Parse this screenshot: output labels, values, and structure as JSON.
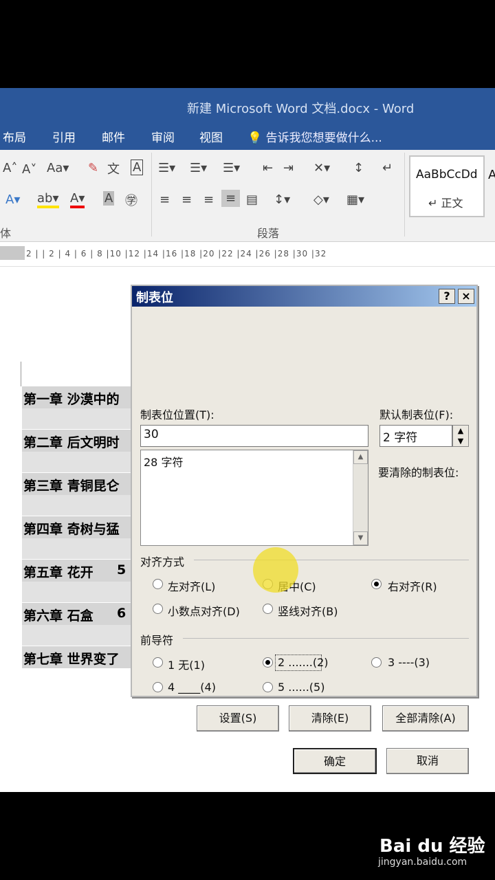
{
  "window": {
    "title": "新建 Microsoft Word 文档.docx - Word"
  },
  "menu": {
    "items": [
      "布局",
      "引用",
      "邮件",
      "审阅",
      "视图"
    ],
    "tellme": "告诉我您想要做什么..."
  },
  "ribbon": {
    "group_font_tail": "体",
    "group_paragraph": "段落",
    "style_preview": "AaBbCcDd",
    "style_name": "↵ 正文",
    "style_next": "A"
  },
  "ruler": {
    "numbers": "2  |  |  2  |  4  |  6  |  8  |10 |12 |14 |16 |18 |20 |22 |24 |26 |28 |30 |32"
  },
  "document": {
    "chapters": [
      {
        "text": "第一章  沙漠中的",
        "page": ""
      },
      {
        "text": "第二章  后文明时",
        "page": ""
      },
      {
        "text": "第三章  青铜昆仑",
        "page": ""
      },
      {
        "text": "第四章  奇树与猛",
        "page": ""
      },
      {
        "text": "第五章  花开",
        "page": "5"
      },
      {
        "text": "第六章  石盒",
        "page": "6"
      },
      {
        "text": "第七章  世界变了",
        "page": ""
      }
    ]
  },
  "dialog": {
    "title": "制表位",
    "help_btn": "?",
    "close_btn": "×",
    "tab_pos_label": "制表位位置(T):",
    "tab_pos_value": "30",
    "default_label": "默认制表位(F):",
    "default_value": "2 字符",
    "list_items": [
      "28 字符"
    ],
    "clear_label": "要清除的制表位:",
    "align_label": "对齐方式",
    "align_options": [
      {
        "label": "左对齐(L)",
        "checked": false
      },
      {
        "label": "居中(C)",
        "checked": false
      },
      {
        "label": "右对齐(R)",
        "checked": true
      },
      {
        "label": "小数点对齐(D)",
        "checked": false
      },
      {
        "label": "竖线对齐(B)",
        "checked": false
      }
    ],
    "leader_label": "前导符",
    "leader_options": [
      {
        "label": "1 无(1)",
        "checked": false
      },
      {
        "label": "2 .......(2)",
        "checked": true
      },
      {
        "label": "3 ----(3)",
        "checked": false
      },
      {
        "label": "4 ____(4)",
        "checked": false
      },
      {
        "label": "5 ......(5)",
        "checked": false
      }
    ],
    "buttons": {
      "set": "设置(S)",
      "clear": "清除(E)",
      "clear_all": "全部清除(A)",
      "ok": "确定",
      "cancel": "取消"
    }
  },
  "watermark": {
    "brand": "Bai du 经验",
    "url": "jingyan.baidu.com"
  }
}
